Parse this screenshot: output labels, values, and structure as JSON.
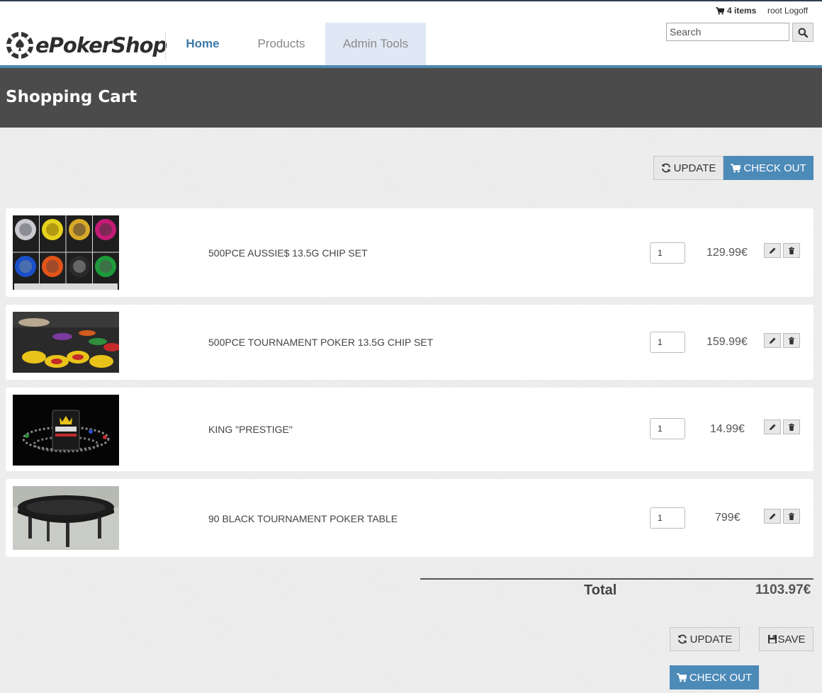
{
  "header": {
    "brand": "ePokerShop",
    "nav": [
      {
        "label": "Home"
      },
      {
        "label": "Products"
      },
      {
        "label": "Admin Tools"
      }
    ],
    "cart_count": "4 items",
    "user": "root",
    "logoff": "Logoff",
    "search_placeholder": "Search"
  },
  "page": {
    "title": "Shopping Cart"
  },
  "buttons": {
    "update": "UPDATE",
    "checkout": "CHECK OUT",
    "save": "SAVE"
  },
  "cart": {
    "items": [
      {
        "name": "500PCE AUSSIE$ 13.5G CHIP SET",
        "qty": "1",
        "price": "129.99€"
      },
      {
        "name": "500PCE TOURNAMENT POKER 13.5G CHIP SET",
        "qty": "1",
        "price": "159.99€"
      },
      {
        "name": "KING \"PRESTIGE\"",
        "qty": "1",
        "price": "14.99€"
      },
      {
        "name": "90 BLACK TOURNAMENT POKER TABLE",
        "qty": "1",
        "price": "799€"
      }
    ],
    "total_label": "Total",
    "total_value": "1103.97€"
  },
  "icons": {
    "cart": "cart-icon",
    "search": "search-icon",
    "refresh": "refresh-icon",
    "edit": "pencil-icon",
    "delete": "trash-icon",
    "save": "save-icon"
  },
  "colors": {
    "accent": "#4c8ab8",
    "banner": "#4b4b4b",
    "nav_active": "#3b79a8"
  }
}
